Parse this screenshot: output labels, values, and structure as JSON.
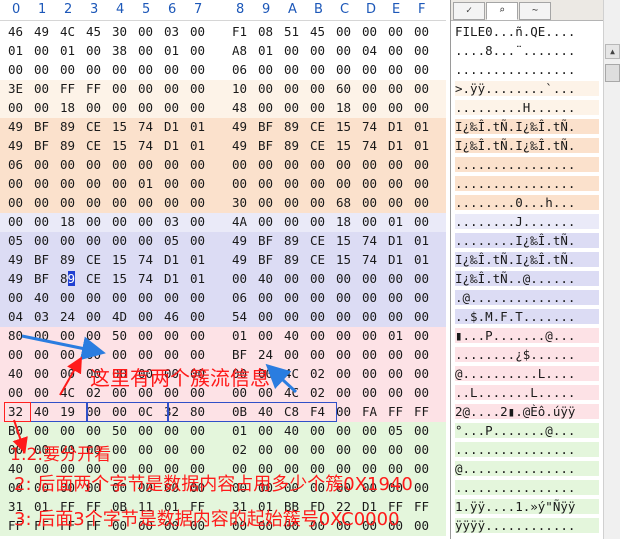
{
  "header_cols": [
    "0",
    "1",
    "2",
    "3",
    "4",
    "5",
    "6",
    "7",
    "8",
    "9",
    "A",
    "B",
    "C",
    "D",
    "E",
    "F"
  ],
  "rows": [
    {
      "bg": "#ffffff",
      "cells": [
        "46",
        "49",
        "4C",
        "45",
        "30",
        "00",
        "03",
        "00",
        "F1",
        "08",
        "51",
        "45",
        "00",
        "00",
        "00",
        "00"
      ]
    },
    {
      "bg": "#ffffff",
      "cells": [
        "01",
        "00",
        "01",
        "00",
        "38",
        "00",
        "01",
        "00",
        "A8",
        "01",
        "00",
        "00",
        "00",
        "04",
        "00",
        "00"
      ]
    },
    {
      "bg": "#ffffff",
      "cells": [
        "00",
        "00",
        "00",
        "00",
        "00",
        "00",
        "00",
        "00",
        "06",
        "00",
        "00",
        "00",
        "00",
        "00",
        "00",
        "00"
      ]
    },
    {
      "bg": "#fdf3e8",
      "cells": [
        "3E",
        "00",
        "FF",
        "FF",
        "00",
        "00",
        "00",
        "00",
        "10",
        "00",
        "00",
        "00",
        "60",
        "00",
        "00",
        "00"
      ]
    },
    {
      "bg": "#fdf3e8",
      "cells": [
        "00",
        "00",
        "18",
        "00",
        "00",
        "00",
        "00",
        "00",
        "48",
        "00",
        "00",
        "00",
        "18",
        "00",
        "00",
        "00"
      ]
    },
    {
      "bg": "#fbe1cc",
      "cells": [
        "49",
        "BF",
        "89",
        "CE",
        "15",
        "74",
        "D1",
        "01",
        "49",
        "BF",
        "89",
        "CE",
        "15",
        "74",
        "D1",
        "01"
      ]
    },
    {
      "bg": "#fbe1cc",
      "cells": [
        "49",
        "BF",
        "89",
        "CE",
        "15",
        "74",
        "D1",
        "01",
        "49",
        "BF",
        "89",
        "CE",
        "15",
        "74",
        "D1",
        "01"
      ]
    },
    {
      "bg": "#fbe1cc",
      "cells": [
        "06",
        "00",
        "00",
        "00",
        "00",
        "00",
        "00",
        "00",
        "00",
        "00",
        "00",
        "00",
        "00",
        "00",
        "00",
        "00"
      ]
    },
    {
      "bg": "#fbe1cc",
      "cells": [
        "00",
        "00",
        "00",
        "00",
        "00",
        "01",
        "00",
        "00",
        "00",
        "00",
        "00",
        "00",
        "00",
        "00",
        "00",
        "00"
      ]
    },
    {
      "bg": "#fbe1cc",
      "cells": [
        "00",
        "00",
        "00",
        "00",
        "00",
        "00",
        "00",
        "00",
        "30",
        "00",
        "00",
        "00",
        "68",
        "00",
        "00",
        "00"
      ]
    },
    {
      "bg": "#eaeaf8",
      "cells": [
        "00",
        "00",
        "18",
        "00",
        "00",
        "00",
        "03",
        "00",
        "4A",
        "00",
        "00",
        "00",
        "18",
        "00",
        "01",
        "00"
      ]
    },
    {
      "bg": "#dcdcf4",
      "cells": [
        "05",
        "00",
        "00",
        "00",
        "00",
        "00",
        "05",
        "00",
        "49",
        "BF",
        "89",
        "CE",
        "15",
        "74",
        "D1",
        "01"
      ]
    },
    {
      "bg": "#dcdcf4",
      "cells": [
        "49",
        "BF",
        "89",
        "CE",
        "15",
        "74",
        "D1",
        "01",
        "49",
        "BF",
        "89",
        "CE",
        "15",
        "74",
        "D1",
        "01"
      ]
    },
    {
      "bg": "#dcdcf4",
      "cells": [
        "49",
        "BF",
        "89",
        "CE",
        "15",
        "74",
        "D1",
        "01",
        "00",
        "40",
        "00",
        "00",
        "00",
        "00",
        "00",
        "00"
      ]
    },
    {
      "bg": "#dcdcf4",
      "cells": [
        "00",
        "40",
        "00",
        "00",
        "00",
        "00",
        "00",
        "00",
        "06",
        "00",
        "00",
        "00",
        "00",
        "00",
        "00",
        "00"
      ]
    },
    {
      "bg": "#dcdcf4",
      "cells": [
        "04",
        "03",
        "24",
        "00",
        "4D",
        "00",
        "46",
        "00",
        "54",
        "00",
        "00",
        "00",
        "00",
        "00",
        "00",
        "00"
      ]
    },
    {
      "bg": "#fde2e6",
      "cells": [
        "80",
        "00",
        "00",
        "00",
        "50",
        "00",
        "00",
        "00",
        "01",
        "00",
        "40",
        "00",
        "00",
        "00",
        "01",
        "00"
      ]
    },
    {
      "bg": "#fde2e6",
      "cells": [
        "00",
        "00",
        "00",
        "00",
        "00",
        "00",
        "00",
        "00",
        "BF",
        "24",
        "00",
        "00",
        "00",
        "00",
        "00",
        "00"
      ]
    },
    {
      "bg": "#fde2e6",
      "cells": [
        "40",
        "00",
        "00",
        "00",
        "00",
        "00",
        "00",
        "00",
        "00",
        "00",
        "4C",
        "02",
        "00",
        "00",
        "00",
        "00"
      ]
    },
    {
      "bg": "#fde2e6",
      "cells": [
        "00",
        "00",
        "4C",
        "02",
        "00",
        "00",
        "00",
        "00",
        "00",
        "00",
        "4C",
        "02",
        "00",
        "00",
        "00",
        "00"
      ]
    },
    {
      "bg": "#fde2e6",
      "cells": [
        "32",
        "40",
        "19",
        "00",
        "00",
        "0C",
        "32",
        "80",
        "0B",
        "40",
        "C8",
        "F4",
        "00",
        "FA",
        "FF",
        "FF"
      ]
    },
    {
      "bg": "#e4f6dc",
      "cells": [
        "B0",
        "00",
        "00",
        "00",
        "50",
        "00",
        "00",
        "00",
        "01",
        "00",
        "40",
        "00",
        "00",
        "00",
        "05",
        "00"
      ]
    },
    {
      "bg": "#e4f6dc",
      "cells": [
        "00",
        "00",
        "00",
        "00",
        "00",
        "00",
        "00",
        "00",
        "02",
        "00",
        "00",
        "00",
        "00",
        "00",
        "00",
        "00"
      ]
    },
    {
      "bg": "#e4f6dc",
      "cells": [
        "40",
        "00",
        "00",
        "00",
        "00",
        "00",
        "00",
        "00",
        "00",
        "00",
        "00",
        "00",
        "00",
        "00",
        "00",
        "00"
      ]
    },
    {
      "bg": "#e4f6dc",
      "cells": [
        "00",
        "00",
        "00",
        "00",
        "00",
        "00",
        "00",
        "00",
        "00",
        "00",
        "00",
        "00",
        "00",
        "00",
        "00",
        "00"
      ]
    },
    {
      "bg": "#e4f6dc",
      "cells": [
        "31",
        "01",
        "FF",
        "FF",
        "0B",
        "11",
        "01",
        "FF",
        "31",
        "01",
        "BB",
        "FD",
        "22",
        "D1",
        "FF",
        "FF"
      ]
    },
    {
      "bg": "#e4f6dc",
      "cells": [
        "FF",
        "FF",
        "FF",
        "FF",
        "00",
        "00",
        "00",
        "00",
        "00",
        "00",
        "00",
        "00",
        "00",
        "00",
        "00",
        "00"
      ]
    }
  ],
  "ascii_rows": [
    "FILE0...ñ.QE....",
    "....8...¨.......",
    "................",
    ">.ÿÿ........`...",
    ".........H......",
    "I¿‰Î.tÑ.I¿‰Î.tÑ.",
    "I¿‰Î.tÑ.I¿‰Î.tÑ.",
    "................",
    "................",
    "........0...h...",
    "........J.......",
    "........I¿‰Î.tÑ.",
    "I¿‰Î.tÑ.I¿‰Î.tÑ.",
    "I¿‰Î.tÑ..@......",
    ".@..............",
    "..$.M.F.T.......",
    "▮...P.......@...",
    "........¿$......",
    "@..........L....",
    "..L.......L.....",
    "2@....2▮.@Èô.úÿÿ",
    "°...P.......@...",
    "................",
    "@...............",
    "................",
    "1.ÿÿ....1.»ý\"Ñÿÿ",
    "ÿÿÿÿ............"
  ],
  "selected_cell": {
    "row": 13,
    "col": 2
  },
  "annotations": {
    "a1": "这里有两个簇流信息",
    "a2": "1:2:要分开看",
    "a3": "2: 后面两个字节是数据内容占用多少个簇0X1940",
    "a4": "3: 后面3个字节是数据内容的起始簇号0XC0000"
  },
  "tabs": [
    "view-tab",
    "search-tab",
    "link-tab"
  ],
  "colors": {
    "annotation": "#ff1a1a",
    "header": "#1c57b8",
    "selection": "#1f3fd1",
    "blue_box": "#3050c8"
  }
}
